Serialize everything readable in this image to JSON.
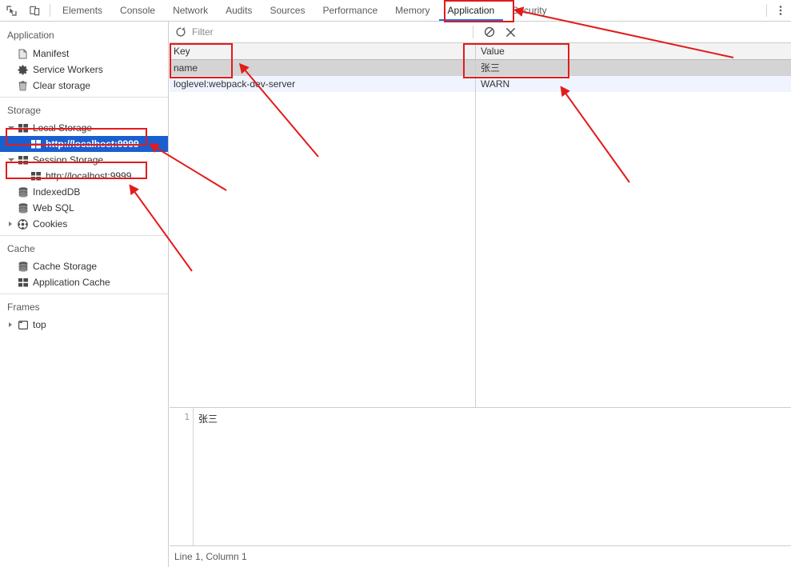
{
  "toolbar": {
    "inspect_icon": "inspect-element-icon",
    "device_icon": "device-toolbar-icon",
    "kebab_icon": "more-options-icon",
    "tabs": [
      {
        "label": "Elements",
        "active": false
      },
      {
        "label": "Console",
        "active": false
      },
      {
        "label": "Network",
        "active": false
      },
      {
        "label": "Audits",
        "active": false
      },
      {
        "label": "Sources",
        "active": false
      },
      {
        "label": "Performance",
        "active": false
      },
      {
        "label": "Memory",
        "active": false
      },
      {
        "label": "Application",
        "active": true
      },
      {
        "label": "Security",
        "active": false
      }
    ]
  },
  "sidebar": {
    "title": "Application",
    "app_items": [
      {
        "label": "Manifest",
        "icon": "manifest-file-icon"
      },
      {
        "label": "Service Workers",
        "icon": "gear-icon"
      },
      {
        "label": "Clear storage",
        "icon": "trash-icon"
      }
    ],
    "storage_group": "Storage",
    "storage_items": [
      {
        "label": "Local Storage",
        "icon": "table-grid-icon",
        "expanded": true,
        "selected": false,
        "child": false
      },
      {
        "label": "http://localhost:9999",
        "icon": "table-grid-icon",
        "expanded": false,
        "selected": true,
        "child": true
      },
      {
        "label": "Session Storage",
        "icon": "table-grid-icon",
        "expanded": true,
        "selected": false,
        "child": false
      },
      {
        "label": "http://localhost:9999",
        "icon": "table-grid-icon",
        "expanded": false,
        "selected": false,
        "child": true
      },
      {
        "label": "IndexedDB",
        "icon": "database-icon",
        "expanded": false,
        "selected": false,
        "child": false
      },
      {
        "label": "Web SQL",
        "icon": "database-icon",
        "expanded": false,
        "selected": false,
        "child": false
      },
      {
        "label": "Cookies",
        "icon": "cookie-icon",
        "expanded": false,
        "selected": false,
        "child": false,
        "collapsed_arrow": true
      }
    ],
    "cache_group": "Cache",
    "cache_items": [
      {
        "label": "Cache Storage",
        "icon": "database-icon"
      },
      {
        "label": "Application Cache",
        "icon": "table-grid-icon"
      }
    ],
    "frames_group": "Frames",
    "frames_items": [
      {
        "label": "top",
        "icon": "frame-window-icon",
        "collapsed_arrow": true
      }
    ]
  },
  "filterbar": {
    "refresh_icon": "refresh-icon",
    "filter_placeholder": "Filter",
    "filter_value": "",
    "clear_all_icon": "clear-all-icon",
    "delete_icon": "delete-selected-icon"
  },
  "table": {
    "columns": [
      "Key",
      "Value"
    ],
    "rows": [
      {
        "key": "name",
        "value": "张三",
        "selected": true
      },
      {
        "key": "loglevel:webpack-dev-server",
        "value": "WARN",
        "selected": false
      }
    ]
  },
  "preview": {
    "line_number": "1",
    "content": "张三"
  },
  "statusbar": {
    "text": "Line 1, Column 1"
  },
  "annotation": {
    "color": "#e21b1b"
  }
}
